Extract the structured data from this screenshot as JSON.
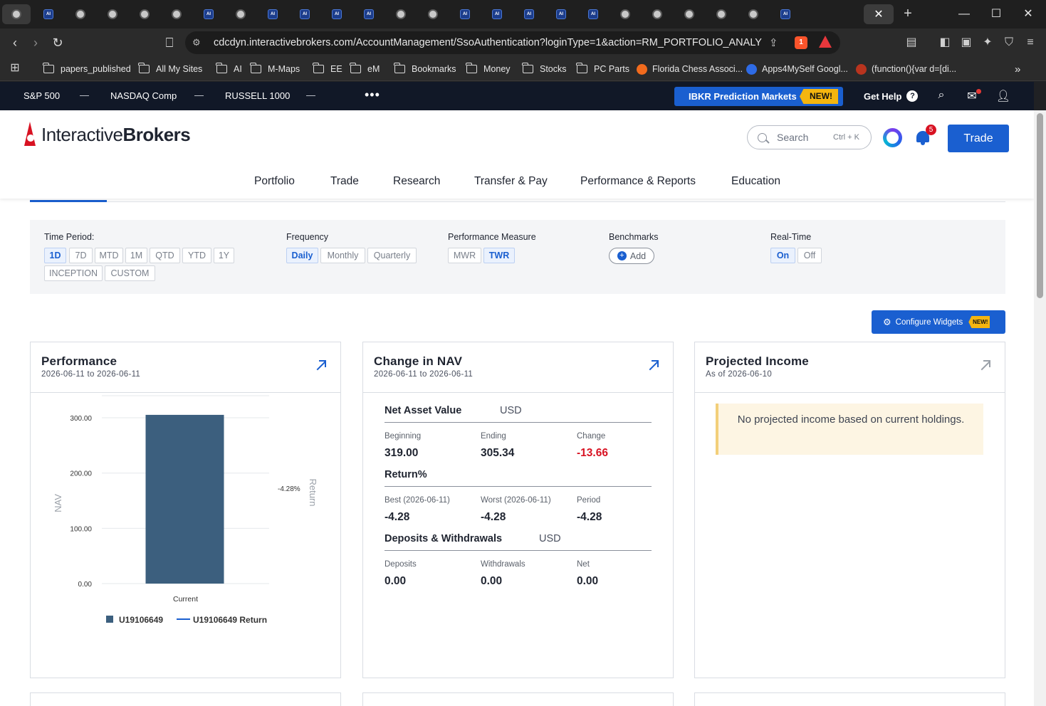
{
  "browser": {
    "url": "cdcdyn.interactivebrokers.com/AccountManagement/SsoAuthentication?loginType=1&action=RM_PORTFOLIO_ANALYST&...",
    "tabs": [
      "globe",
      "ai",
      "globe",
      "globe",
      "globe",
      "globe",
      "ai",
      "globe",
      "ai",
      "ai",
      "ai",
      "ai",
      "globe",
      "globe",
      "ai",
      "ai",
      "ai",
      "ai",
      "ai",
      "globe",
      "globe",
      "globe",
      "globe",
      "globe",
      "ai"
    ],
    "active_tab_icon": "close-icon",
    "brave_badge": "1",
    "bookmarks": [
      {
        "label": "papers_published",
        "icon": "folder-icon"
      },
      {
        "label": "All My Sites",
        "icon": "folder-icon"
      },
      {
        "label": "AI",
        "icon": "folder-icon"
      },
      {
        "label": "M-Maps",
        "icon": "folder-icon"
      },
      {
        "label": "EE",
        "icon": "folder-icon"
      },
      {
        "label": "eM",
        "icon": "folder-icon"
      },
      {
        "label": "Bookmarks",
        "icon": "folder-icon"
      },
      {
        "label": "Money",
        "icon": "folder-icon"
      },
      {
        "label": "Stocks",
        "icon": "folder-icon"
      },
      {
        "label": "PC Parts",
        "icon": "folder-icon"
      },
      {
        "label": "Florida Chess Associ...",
        "icon": "favicon"
      },
      {
        "label": "Apps4MySelf Googl...",
        "icon": "favicon"
      },
      {
        "label": "(function(){var d=[di...",
        "icon": "favicon"
      }
    ],
    "bookmarks_more": "»"
  },
  "ticker": {
    "items": [
      {
        "label": "S&P 500",
        "value": "—"
      },
      {
        "label": "NASDAQ Comp",
        "value": "—"
      },
      {
        "label": "RUSSELL 1000",
        "value": "—"
      }
    ],
    "more": "•••",
    "prediction_label": "IBKR Prediction Markets",
    "prediction_badge": "NEW!",
    "get_help": "Get Help",
    "help_icon": "?"
  },
  "header": {
    "logo_light": "Interactive",
    "logo_bold": "Brokers",
    "search_placeholder": "Search",
    "search_shortcut": "Ctrl + K",
    "notification_count": "5",
    "trade_button": "Trade",
    "nav": [
      "Portfolio",
      "Trade",
      "Research",
      "Transfer & Pay",
      "Performance & Reports",
      "Education"
    ]
  },
  "filters": {
    "time_period": {
      "label": "Time Period:",
      "options": [
        "1D",
        "7D",
        "MTD",
        "1M",
        "QTD",
        "YTD",
        "1Y",
        "INCEPTION",
        "CUSTOM"
      ],
      "selected": "1D"
    },
    "frequency": {
      "label": "Frequency",
      "options": [
        "Daily",
        "Monthly",
        "Quarterly"
      ],
      "selected": "Daily"
    },
    "performance_measure": {
      "label": "Performance Measure",
      "options": [
        "MWR",
        "TWR"
      ],
      "selected": "TWR"
    },
    "benchmarks": {
      "label": "Benchmarks",
      "add_label": "Add"
    },
    "real_time": {
      "label": "Real-Time",
      "options": [
        "On",
        "Off"
      ],
      "selected": "On"
    }
  },
  "configure_widgets": {
    "label": "Configure Widgets",
    "badge": "NEW!"
  },
  "performance_widget": {
    "title": "Performance",
    "subtitle": "2026-06-11 to 2026-06-11",
    "legend_series": "U19106649",
    "legend_return": "U19106649 Return"
  },
  "chart_data": {
    "type": "bar",
    "categories": [
      "Current"
    ],
    "series": [
      {
        "name": "U19106649",
        "values": [
          305.34
        ],
        "color": "#3c5f7e"
      },
      {
        "name": "U19106649 Return",
        "values": [
          -4.28
        ],
        "unit": "%",
        "type": "line",
        "color": "#1a5fd0"
      }
    ],
    "ylabel": "NAV",
    "y2label": "Return",
    "ylim": [
      0,
      340
    ],
    "yticks": [
      "0.00",
      "100.00",
      "200.00",
      "300.00"
    ],
    "ytick_values": [
      0,
      100,
      200,
      300
    ],
    "y2_tick_label": "-4.28%",
    "y2_tick_value": -4.28,
    "grid": true,
    "legend_position": "bottom"
  },
  "nav_widget": {
    "title": "Change in NAV",
    "subtitle": "2026-06-11 to 2026-06-11",
    "nav": {
      "heading": "Net Asset Value",
      "currency": "USD",
      "columns": [
        {
          "label": "Beginning",
          "value": "319.00"
        },
        {
          "label": "Ending",
          "value": "305.34"
        },
        {
          "label": "Change",
          "value": "-13.66"
        }
      ]
    },
    "return": {
      "heading": "Return%",
      "columns": [
        {
          "label": "Best (2026-06-11)",
          "value": "-4.28"
        },
        {
          "label": "Worst (2026-06-11)",
          "value": "-4.28"
        },
        {
          "label": "Period",
          "value": "-4.28"
        }
      ]
    },
    "deposits": {
      "heading": "Deposits & Withdrawals",
      "currency": "USD",
      "columns": [
        {
          "label": "Deposits",
          "value": "0.00"
        },
        {
          "label": "Withdrawals",
          "value": "0.00"
        },
        {
          "label": "Net",
          "value": "0.00"
        }
      ]
    }
  },
  "income_widget": {
    "title": "Projected Income",
    "subtitle": "As of 2026-06-10",
    "message": "No projected income based on current holdings."
  },
  "colors": {
    "accent": "#1a5fd0",
    "negative": "#d81222",
    "bar": "#3c5f7e",
    "ticker_bg": "#111827",
    "badge": "#f5b50f"
  }
}
